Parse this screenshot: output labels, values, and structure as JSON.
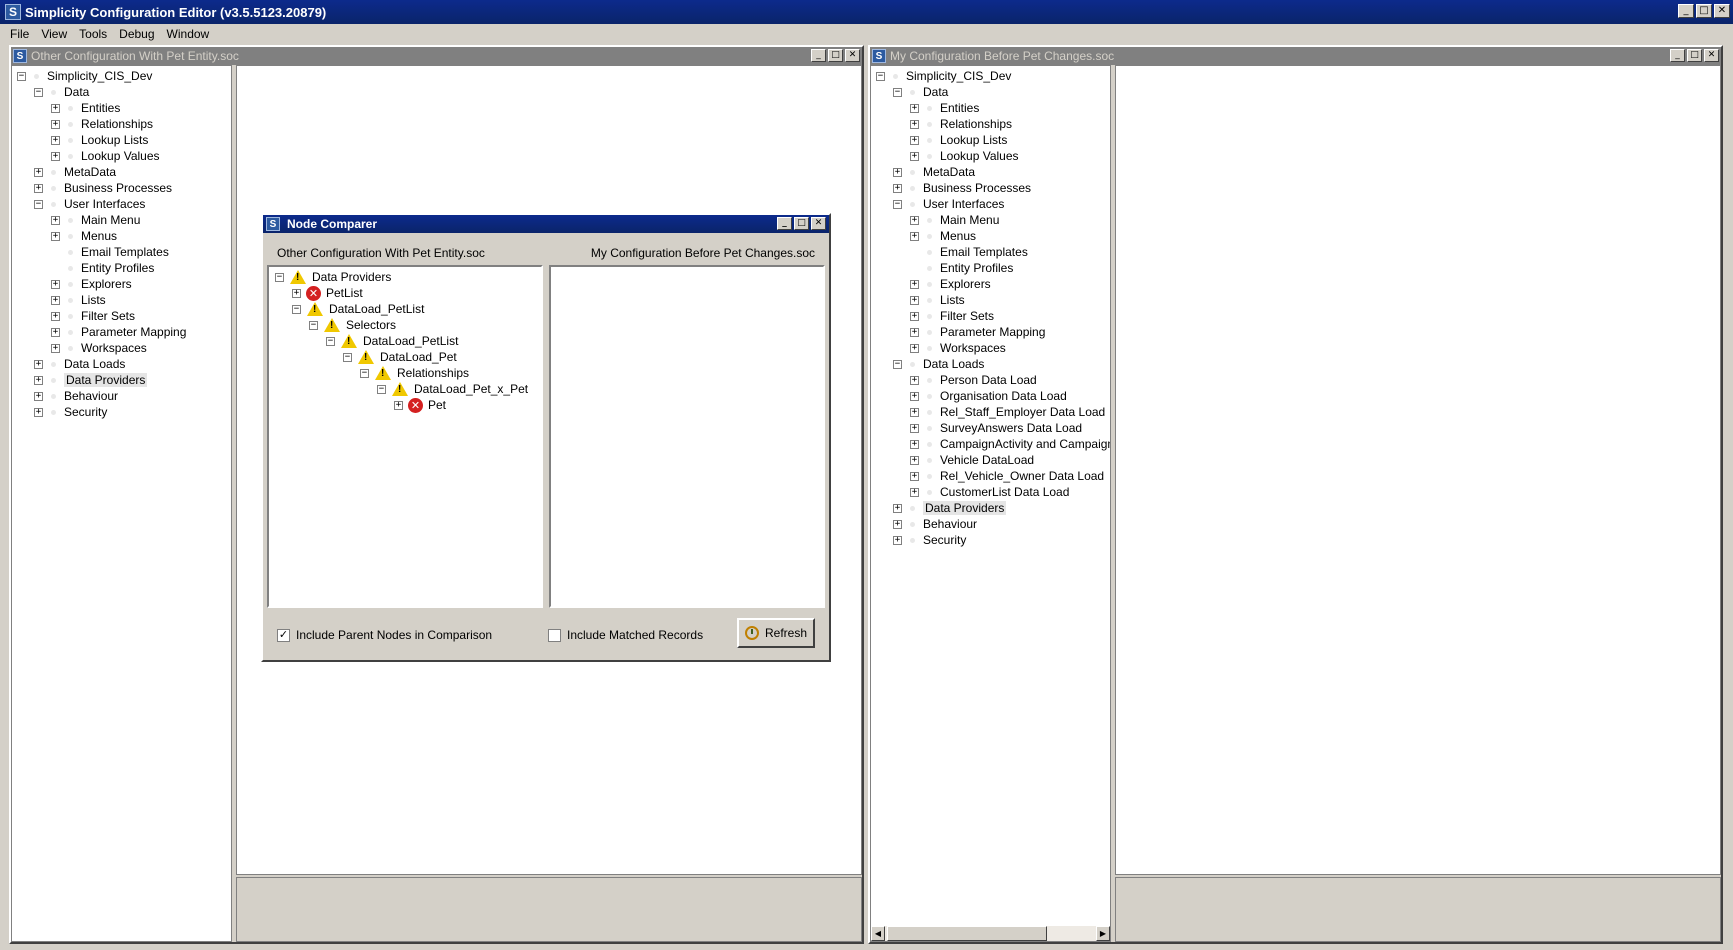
{
  "app": {
    "title": "Simplicity Configuration Editor (v3.5.5123.20879)",
    "icon_letter": "S",
    "window_buttons": [
      "_",
      "□",
      "✕"
    ]
  },
  "menu": [
    "File",
    "View",
    "Tools",
    "Debug",
    "Window"
  ],
  "left_window": {
    "title": "Other Configuration With Pet Entity.soc",
    "tree": [
      {
        "label": "Simplicity_CIS_Dev",
        "level": 0,
        "toggle": "-"
      },
      {
        "label": "Data",
        "level": 1,
        "toggle": "-"
      },
      {
        "label": "Entities",
        "level": 2,
        "toggle": "+"
      },
      {
        "label": "Relationships",
        "level": 2,
        "toggle": "+"
      },
      {
        "label": "Lookup Lists",
        "level": 2,
        "toggle": "+"
      },
      {
        "label": "Lookup Values",
        "level": 2,
        "toggle": "+"
      },
      {
        "label": "MetaData",
        "level": 1,
        "toggle": "+"
      },
      {
        "label": "Business Processes",
        "level": 1,
        "toggle": "+"
      },
      {
        "label": "User Interfaces",
        "level": 1,
        "toggle": "-"
      },
      {
        "label": "Main Menu",
        "level": 2,
        "toggle": "+"
      },
      {
        "label": "Menus",
        "level": 2,
        "toggle": "+"
      },
      {
        "label": "Email Templates",
        "level": 2,
        "toggle": ""
      },
      {
        "label": "Entity Profiles",
        "level": 2,
        "toggle": ""
      },
      {
        "label": "Explorers",
        "level": 2,
        "toggle": "+"
      },
      {
        "label": "Lists",
        "level": 2,
        "toggle": "+"
      },
      {
        "label": "Filter Sets",
        "level": 2,
        "toggle": "+"
      },
      {
        "label": "Parameter Mapping",
        "level": 2,
        "toggle": "+"
      },
      {
        "label": "Workspaces",
        "level": 2,
        "toggle": "+"
      },
      {
        "label": "Data Loads",
        "level": 1,
        "toggle": "+"
      },
      {
        "label": "Data Providers",
        "level": 1,
        "toggle": "+",
        "selected": true
      },
      {
        "label": "Behaviour",
        "level": 1,
        "toggle": "+"
      },
      {
        "label": "Security",
        "level": 1,
        "toggle": "+"
      }
    ]
  },
  "right_window": {
    "title": "My Configuration Before Pet Changes.soc",
    "tree": [
      {
        "label": "Simplicity_CIS_Dev",
        "level": 0,
        "toggle": "-"
      },
      {
        "label": "Data",
        "level": 1,
        "toggle": "-"
      },
      {
        "label": "Entities",
        "level": 2,
        "toggle": "+"
      },
      {
        "label": "Relationships",
        "level": 2,
        "toggle": "+"
      },
      {
        "label": "Lookup Lists",
        "level": 2,
        "toggle": "+"
      },
      {
        "label": "Lookup Values",
        "level": 2,
        "toggle": "+"
      },
      {
        "label": "MetaData",
        "level": 1,
        "toggle": "+"
      },
      {
        "label": "Business Processes",
        "level": 1,
        "toggle": "+"
      },
      {
        "label": "User Interfaces",
        "level": 1,
        "toggle": "-"
      },
      {
        "label": "Main Menu",
        "level": 2,
        "toggle": "+"
      },
      {
        "label": "Menus",
        "level": 2,
        "toggle": "+"
      },
      {
        "label": "Email Templates",
        "level": 2,
        "toggle": ""
      },
      {
        "label": "Entity Profiles",
        "level": 2,
        "toggle": ""
      },
      {
        "label": "Explorers",
        "level": 2,
        "toggle": "+"
      },
      {
        "label": "Lists",
        "level": 2,
        "toggle": "+"
      },
      {
        "label": "Filter Sets",
        "level": 2,
        "toggle": "+"
      },
      {
        "label": "Parameter Mapping",
        "level": 2,
        "toggle": "+"
      },
      {
        "label": "Workspaces",
        "level": 2,
        "toggle": "+"
      },
      {
        "label": "Data Loads",
        "level": 1,
        "toggle": "-"
      },
      {
        "label": "Person Data Load",
        "level": 2,
        "toggle": "+"
      },
      {
        "label": "Organisation Data Load",
        "level": 2,
        "toggle": "+"
      },
      {
        "label": "Rel_Staff_Employer Data Load",
        "level": 2,
        "toggle": "+"
      },
      {
        "label": "SurveyAnswers Data Load",
        "level": 2,
        "toggle": "+"
      },
      {
        "label": "CampaignActivity and CampaignL",
        "level": 2,
        "toggle": "+"
      },
      {
        "label": "Vehicle DataLoad",
        "level": 2,
        "toggle": "+"
      },
      {
        "label": "Rel_Vehicle_Owner Data Load",
        "level": 2,
        "toggle": "+"
      },
      {
        "label": "CustomerList Data Load",
        "level": 2,
        "toggle": "+"
      },
      {
        "label": "Data Providers",
        "level": 1,
        "toggle": "+",
        "selected": true
      },
      {
        "label": "Behaviour",
        "level": 1,
        "toggle": "+"
      },
      {
        "label": "Security",
        "level": 1,
        "toggle": "+"
      }
    ]
  },
  "dialog": {
    "title": "Node Comparer",
    "left_label": "Other Configuration With Pet Entity.soc",
    "right_label": "My Configuration Before Pet Changes.soc",
    "tree": [
      {
        "label": "Data Providers",
        "level": 0,
        "toggle": "-",
        "status": "warning"
      },
      {
        "label": "PetList",
        "level": 1,
        "toggle": "+",
        "status": "error"
      },
      {
        "label": "DataLoad_PetList",
        "level": 1,
        "toggle": "-",
        "status": "warning"
      },
      {
        "label": "Selectors",
        "level": 2,
        "toggle": "-",
        "status": "warning"
      },
      {
        "label": "DataLoad_PetList",
        "level": 3,
        "toggle": "-",
        "status": "warning"
      },
      {
        "label": "DataLoad_Pet",
        "level": 4,
        "toggle": "-",
        "status": "warning"
      },
      {
        "label": "Relationships",
        "level": 5,
        "toggle": "-",
        "status": "warning"
      },
      {
        "label": "DataLoad_Pet_x_Pet",
        "level": 6,
        "toggle": "-",
        "status": "warning"
      },
      {
        "label": "Pet",
        "level": 7,
        "toggle": "+",
        "status": "error"
      }
    ],
    "include_parent_label": "Include Parent Nodes in Comparison",
    "include_parent_checked": true,
    "include_matched_label": "Include Matched Records",
    "include_matched_checked": false,
    "refresh_label": "Refresh"
  }
}
